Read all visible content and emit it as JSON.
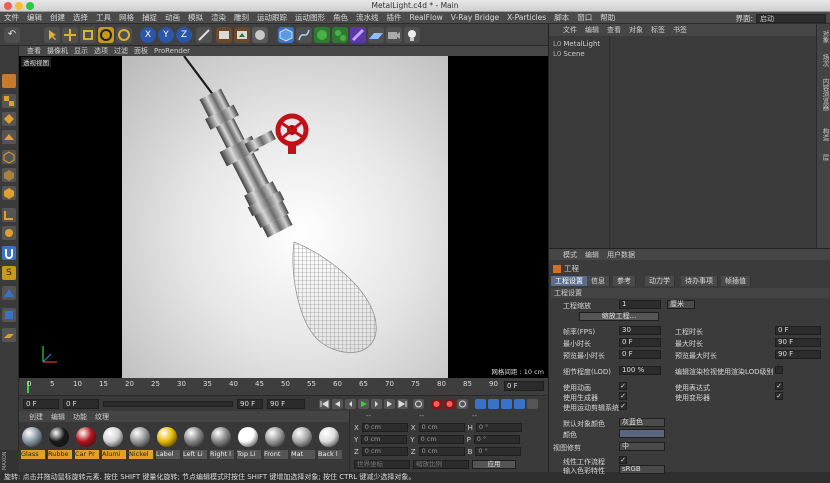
{
  "window": {
    "title": "MetalLight.c4d * - Main"
  },
  "menubar": {
    "items": [
      "文件",
      "编辑",
      "创建",
      "选择",
      "工具",
      "网格",
      "捕捉",
      "动画",
      "模拟",
      "渲染",
      "雕刻",
      "运动跟踪",
      "运动图形",
      "角色",
      "流水线",
      "插件",
      "RealFlow",
      "V-Ray Bridge",
      "X-Particles",
      "脚本",
      "窗口",
      "帮助"
    ],
    "layout_label": "界面:",
    "layout_value": "启动"
  },
  "viewport": {
    "menu": [
      "查看",
      "摄像机",
      "显示",
      "选项",
      "过滤",
      "面板",
      "ProRender"
    ],
    "label": "透视视图",
    "grid_info": "网格间距 : 10 cm"
  },
  "timeline": {
    "ticks": [
      "0",
      "5",
      "10",
      "15",
      "20",
      "25",
      "30",
      "35",
      "40",
      "45",
      "50",
      "55",
      "60",
      "65",
      "70",
      "75",
      "80",
      "85",
      "90"
    ],
    "frame_readout": "0 F",
    "start_field": "0 F",
    "current_field": "0 F",
    "end_field": "90 F",
    "max_field": "90 F"
  },
  "materials": {
    "menu": [
      "创建",
      "编辑",
      "功能",
      "纹理"
    ],
    "items": [
      {
        "label": "Glass",
        "color": "#8a9aa6",
        "selected": true
      },
      {
        "label": "Rubbe",
        "color": "#1a1a1a",
        "selected": true
      },
      {
        "label": "Car Pr",
        "color": "#b3141b",
        "selected": true
      },
      {
        "label": "Alumi",
        "color": "#d4d4d4",
        "selected": true
      },
      {
        "label": "Nickel",
        "color": "#9a9a9a",
        "selected": true
      },
      {
        "label": "Label",
        "color": "#e6b800",
        "selected": false
      },
      {
        "label": "Left Li",
        "color": "#888888",
        "selected": false
      },
      {
        "label": "Right l",
        "color": "#888888",
        "selected": false
      },
      {
        "label": "Top Li",
        "color": "#ffffff",
        "selected": false
      },
      {
        "label": "Front",
        "color": "#9a9a9a",
        "selected": false
      },
      {
        "label": "Mat",
        "color": "#aaaaaa",
        "selected": false
      },
      {
        "label": "Back l",
        "color": "#dddddd",
        "selected": false
      }
    ]
  },
  "coordinates": {
    "header": [
      "--",
      "--",
      "--"
    ],
    "rows": [
      {
        "a": "X",
        "av": "0 cm",
        "b": "X",
        "bv": "0 cm",
        "c": "H",
        "cv": "0 °"
      },
      {
        "a": "Y",
        "av": "0 cm",
        "b": "Y",
        "bv": "0 cm",
        "c": "P",
        "cv": "0 °"
      },
      {
        "a": "Z",
        "av": "0 cm",
        "b": "Z",
        "bv": "0 cm",
        "c": "B",
        "cv": "0 °"
      }
    ],
    "mode1": "世界坐标",
    "mode2": "缩放比例",
    "apply": "应用"
  },
  "status": {
    "text": "旋转: 点击并拖动鼠标旋转元素. 按住 SHIFT 键量化旋转; 节点编辑模式时按住 SHIFT 键增加选择对象; 按住 CTRL 键减少选择对象。"
  },
  "object_manager": {
    "menu": [
      "文件",
      "编辑",
      "查看",
      "对象",
      "标签",
      "书签"
    ],
    "objects": [
      "MetalLight",
      "Scene"
    ],
    "right_tabs": [
      "对象",
      "场次",
      "内容浏览器",
      "构造",
      "层"
    ]
  },
  "attribute_manager": {
    "menu": [
      "模式",
      "编辑",
      "用户数据"
    ],
    "title": "工程",
    "tabs": [
      "工程设置",
      "信息",
      "参考",
      "动力学",
      "待办事项",
      "帧插值"
    ],
    "section": "工程设置",
    "scale_label": "工程缩放",
    "scale_value": "1",
    "scale_unit": "厘米",
    "scale_button": "缩放工程...",
    "fps_label": "帧率(FPS)",
    "fps_value": "30",
    "time_label": "工程时长",
    "time_value": "0 F",
    "min_label": "最小时长",
    "min_value": "0 F",
    "max_label": "最大时长",
    "max_value": "90 F",
    "pmin_label": "预览最小时长",
    "pmin_value": "0 F",
    "pmax_label": "预览最大时长",
    "pmax_value": "90 F",
    "lod_label": "细节程度(LOD)",
    "lod_value": "100 %",
    "lod_check": "编辑渲染检视使用渲染LOD级别",
    "anim_label": "使用动画",
    "expr_label": "使用表达式",
    "gen_label": "使用生成器",
    "deform_label": "使用变形器",
    "motion_label": "使用运动剪辑系统",
    "defcolor_label": "默认对象颜色",
    "defcolor_value": "灰蓝色",
    "color_label": "颜色",
    "clip_label": "视图修剪",
    "clip_value": "中",
    "linear_label": "线性工作流程",
    "input_label": "输入色彩特性",
    "input_value": "sRGB"
  }
}
